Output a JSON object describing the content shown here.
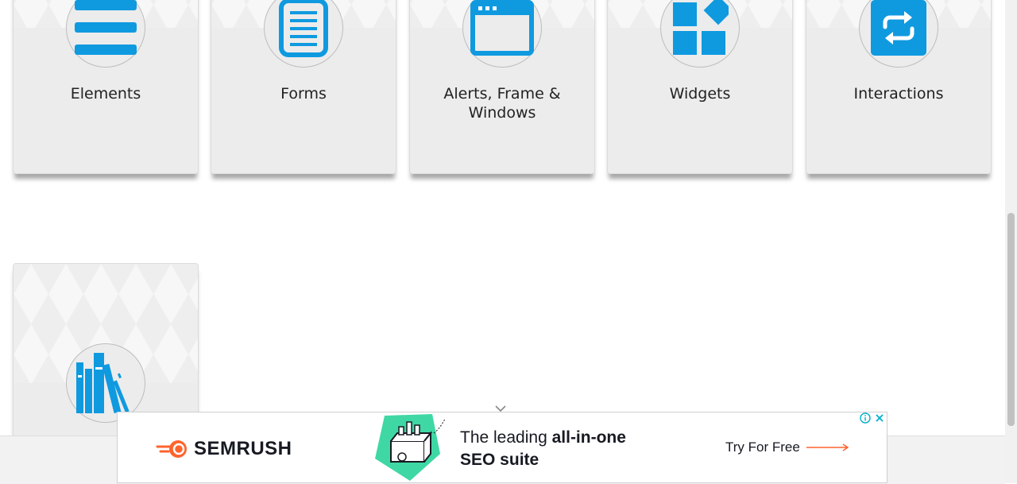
{
  "cards": [
    {
      "title": "Elements",
      "icon": "menu-lines-icon"
    },
    {
      "title": "Forms",
      "icon": "document-form-icon"
    },
    {
      "title": "Alerts, Frame & Windows",
      "icon": "browser-window-icon"
    },
    {
      "title": "Widgets",
      "icon": "widgets-blocks-icon"
    },
    {
      "title": "Interactions",
      "icon": "swap-arrows-icon"
    },
    {
      "title": "",
      "icon": "book-stack-icon"
    }
  ],
  "ad": {
    "brand": "SEMRUSH",
    "headline_prefix": "The leading ",
    "headline_bold": "all-in-one",
    "headline_line2": "SEO suite",
    "cta": "Try For Free"
  },
  "colors": {
    "accent": "#0f9ae0",
    "brand_orange": "#ff642d",
    "ad_green": "#3fd8a4",
    "card_bg": "#ececec"
  }
}
